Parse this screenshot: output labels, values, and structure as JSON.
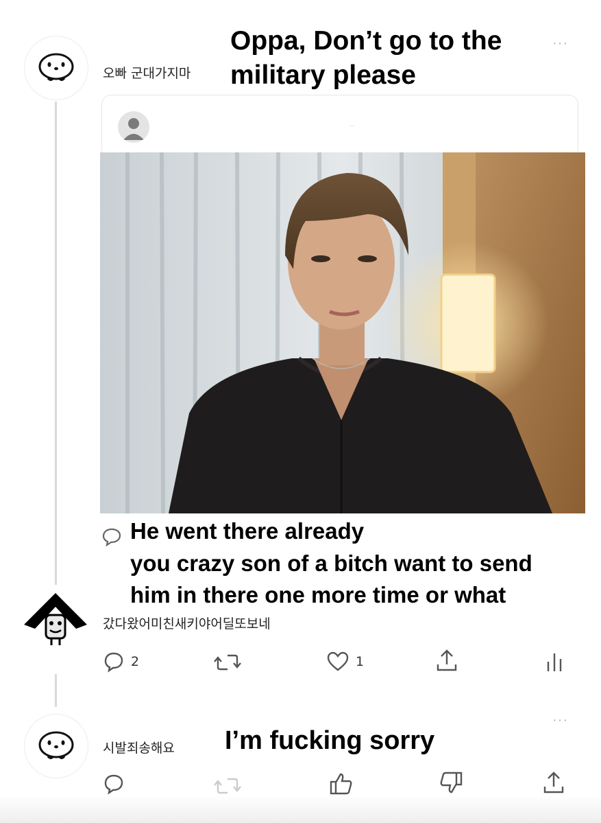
{
  "post": {
    "username": "오빠 군대가지마",
    "caption_line1": "Oppa, Don’t go to the",
    "caption_line2": "military please",
    "more_label": "···"
  },
  "quote": {
    "title": "··"
  },
  "reply1": {
    "caption_line1": "He went there already",
    "caption_line2": "you crazy son of a bitch want to send",
    "caption_line3": "him in there one more time or what",
    "username": "갔다왔어미친새키야어딜또보네",
    "reply_count": "2",
    "like_count": "1"
  },
  "reply2": {
    "username": "시발죄송해요",
    "caption": "I’m fucking sorry",
    "more_label": "···"
  },
  "icons": {
    "comment": "speech-bubble-icon",
    "retweet": "repeat-icon",
    "like": "heart-icon",
    "share": "share-upload-icon",
    "stats": "bar-chart-icon",
    "thumb_up": "thumbs-up-icon",
    "thumb_down": "thumbs-down-icon"
  },
  "colors": {
    "icon": "#555555",
    "text": "#000000",
    "thread_line": "#d9d9d9"
  }
}
